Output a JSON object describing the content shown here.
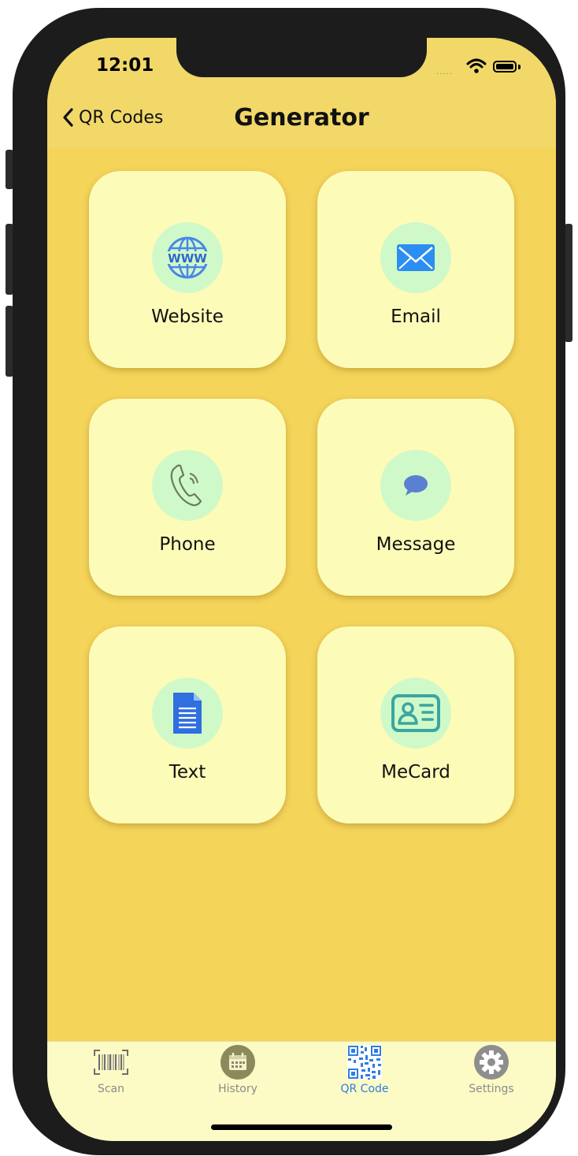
{
  "status_bar": {
    "time": "12:01",
    "signal": "....."
  },
  "nav": {
    "back_label": "QR Codes",
    "title": "Generator"
  },
  "tiles": [
    {
      "label": "Website",
      "icon": "globe-www-icon"
    },
    {
      "label": "Email",
      "icon": "envelope-icon"
    },
    {
      "label": "Phone",
      "icon": "phone-handset-icon"
    },
    {
      "label": "Message",
      "icon": "chat-bubble-icon"
    },
    {
      "label": "Text",
      "icon": "document-icon"
    },
    {
      "label": "MeCard",
      "icon": "contact-card-icon"
    }
  ],
  "tabbar": {
    "items": [
      {
        "label": "Scan",
        "icon": "barcode-icon",
        "active": false
      },
      {
        "label": "History",
        "icon": "calendar-icon",
        "active": false
      },
      {
        "label": "QR Code",
        "icon": "qr-code-icon",
        "active": true
      },
      {
        "label": "Settings",
        "icon": "gear-icon",
        "active": false
      }
    ]
  },
  "colors": {
    "background": "#f5d45a",
    "navbar": "#f1d869",
    "tile": "#fdfbb8",
    "icon_circle": "#d0f9c9",
    "tabbar": "#fcfbc6",
    "active_tab": "#2f7ee0"
  }
}
